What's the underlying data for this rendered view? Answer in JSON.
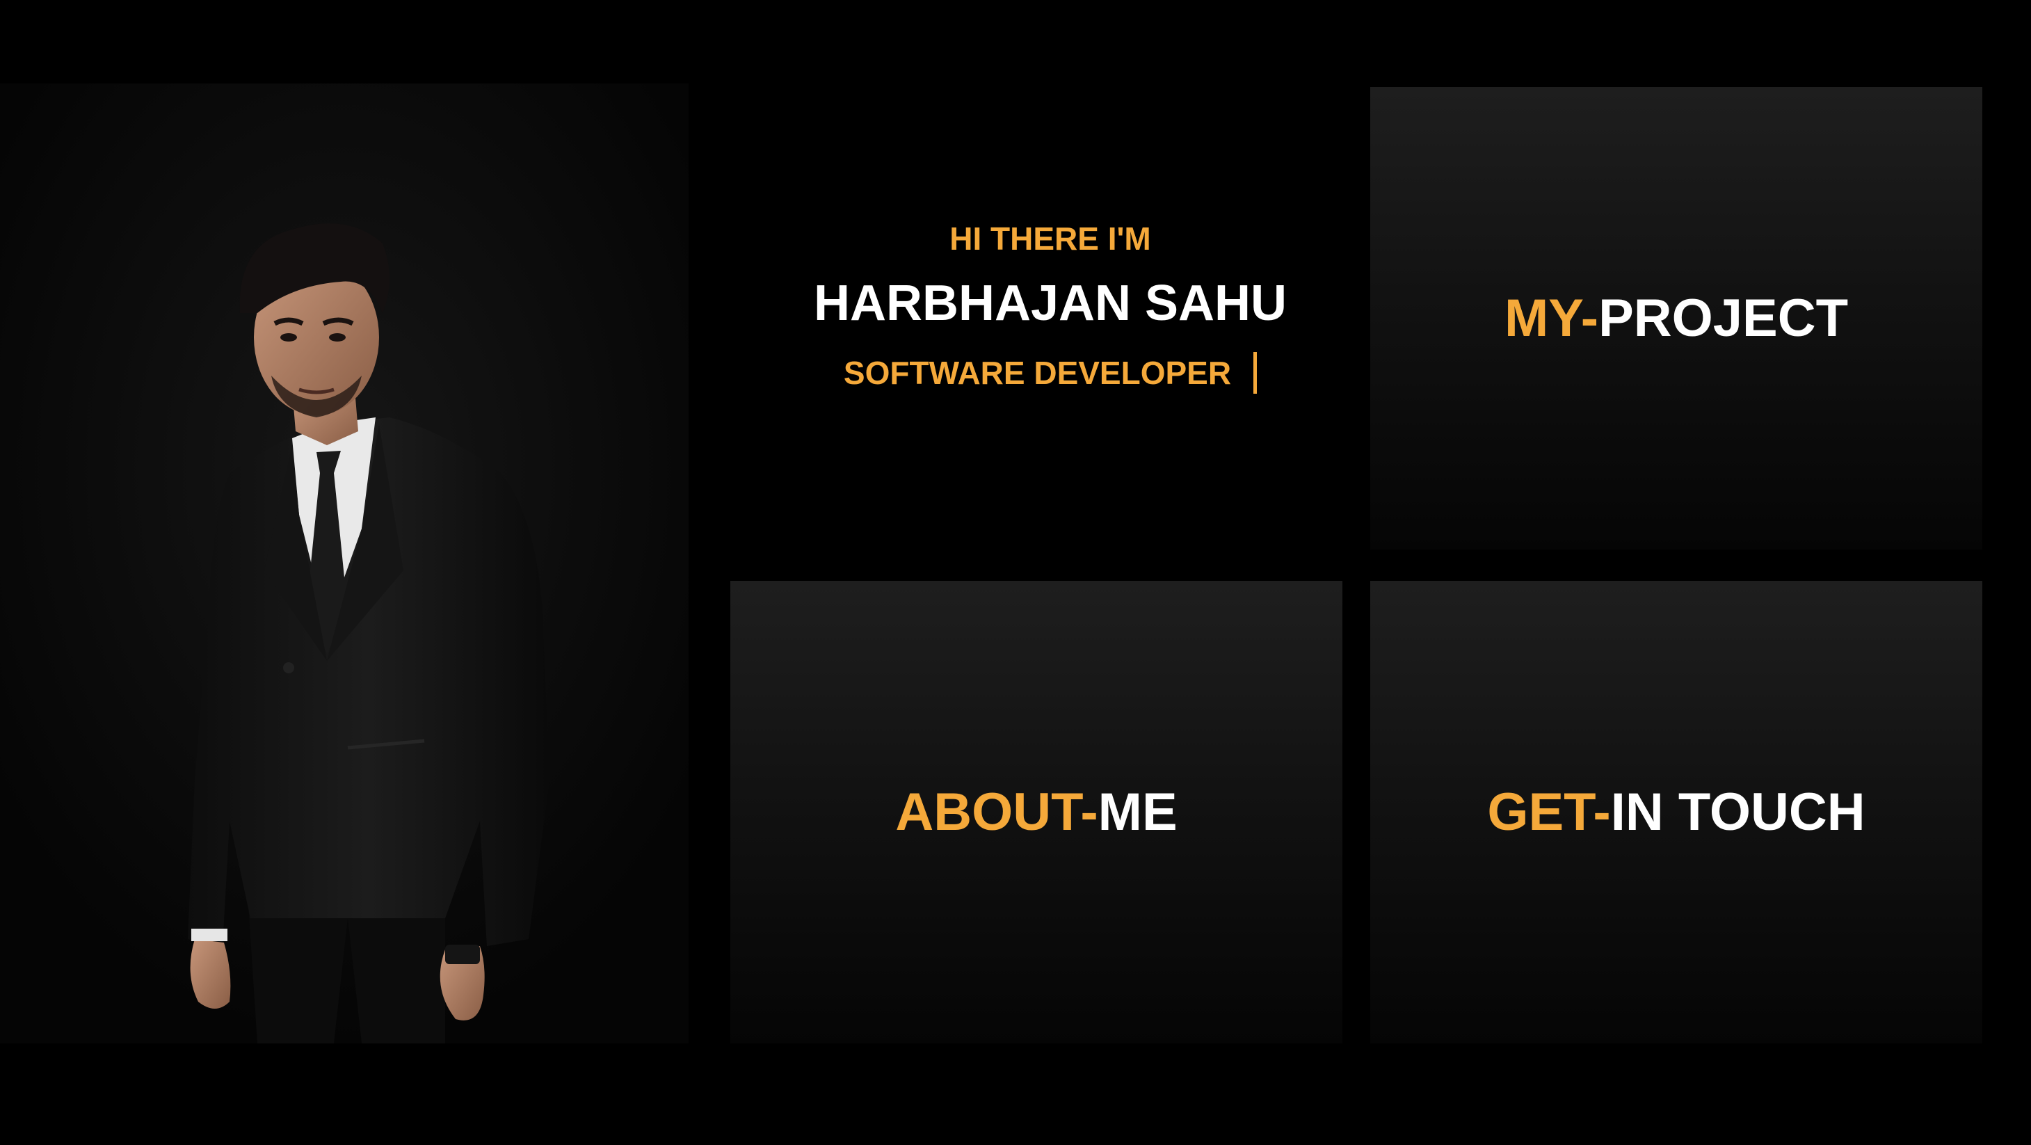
{
  "intro": {
    "greeting": "HI THERE I'M",
    "name": "HARBHAJAN SAHU",
    "role": "SOFTWARE DEVELOPER"
  },
  "nav": {
    "project": {
      "accent": "MY-",
      "rest": "PROJECT"
    },
    "about": {
      "accent": "ABOUT-",
      "rest": "ME"
    },
    "contact": {
      "accent": "GET-",
      "rest": "IN TOUCH"
    }
  },
  "colors": {
    "accent": "#F5A93A",
    "text": "#FFFFFF",
    "background": "#000000"
  },
  "icons": {
    "portrait": "person-portrait-photo"
  }
}
